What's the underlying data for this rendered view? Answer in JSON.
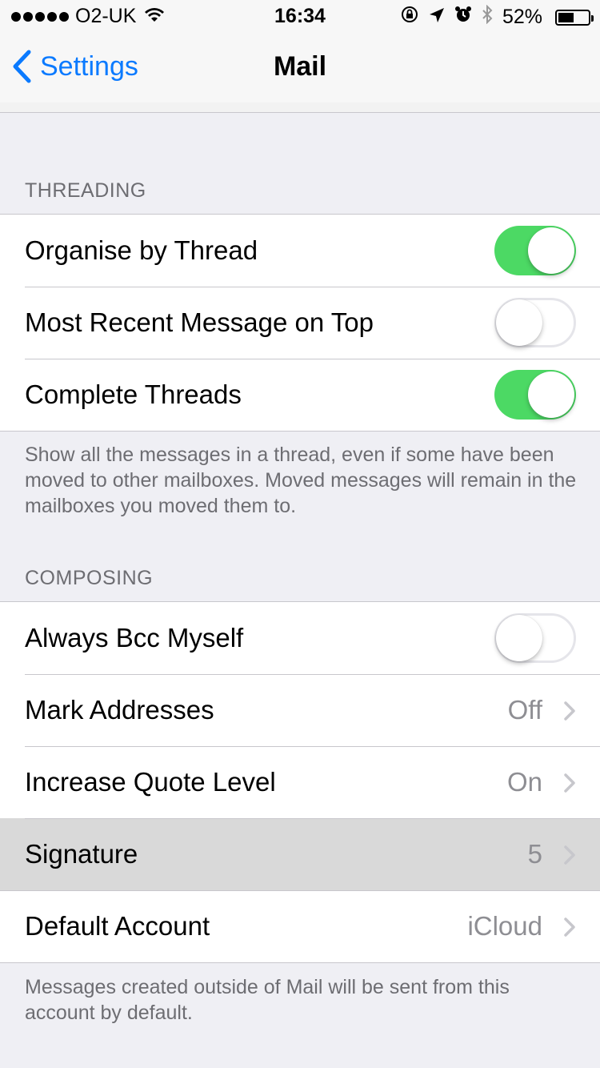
{
  "status_bar": {
    "carrier": "O2-UK",
    "time": "16:34",
    "battery_percent": "52%",
    "battery_level": 0.52,
    "icons": [
      "signal-dots-icon",
      "wifi-icon",
      "rotation-lock-icon",
      "location-icon",
      "alarm-icon",
      "bluetooth-icon",
      "battery-icon"
    ]
  },
  "nav": {
    "back_label": "Settings",
    "title": "Mail"
  },
  "threading": {
    "header": "THREADING",
    "rows": [
      {
        "label": "Organise by Thread",
        "toggle": true
      },
      {
        "label": "Most Recent Message on Top",
        "toggle": false
      },
      {
        "label": "Complete Threads",
        "toggle": true
      }
    ],
    "footer": "Show all the messages in a thread, even if some have been moved to other mailboxes. Moved messages will remain in the mailboxes you moved them to."
  },
  "composing": {
    "header": "COMPOSING",
    "rows": [
      {
        "label": "Always Bcc Myself",
        "toggle": false
      },
      {
        "label": "Mark Addresses",
        "value": "Off"
      },
      {
        "label": "Increase Quote Level",
        "value": "On"
      },
      {
        "label": "Signature",
        "value": "5",
        "highlighted": true
      },
      {
        "label": "Default Account",
        "value": "iCloud"
      }
    ],
    "footer": "Messages created outside of Mail will be sent from this account by default."
  },
  "colors": {
    "accent": "#0a7aff",
    "toggle_on": "#4cd964",
    "background": "#efeff4"
  }
}
